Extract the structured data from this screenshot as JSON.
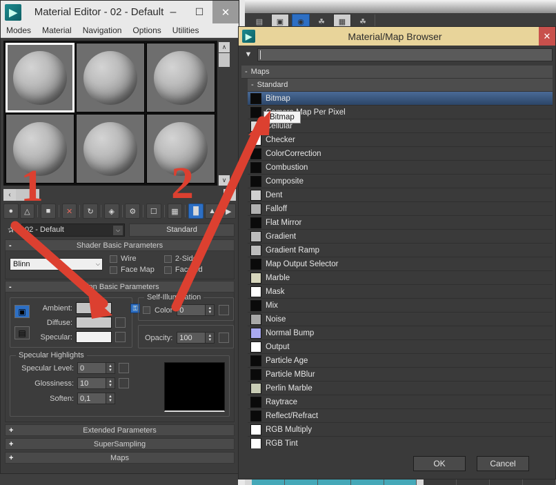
{
  "material_editor": {
    "title": "Material Editor - 02 - Default",
    "logo_glyph": "▶",
    "window_buttons": {
      "minimize": "–",
      "maximize": "☐",
      "close": "✕"
    },
    "menus": [
      "Modes",
      "Material",
      "Navigation",
      "Options",
      "Utilities"
    ],
    "slots": [
      {
        "name": "slot-1",
        "active": true
      },
      {
        "name": "slot-2",
        "active": false
      },
      {
        "name": "slot-3",
        "active": false
      },
      {
        "name": "slot-4",
        "active": false
      },
      {
        "name": "slot-5",
        "active": false
      },
      {
        "name": "slot-6",
        "active": false
      }
    ],
    "slot_scroll": {
      "up": "∧",
      "down": "∨",
      "left": "‹",
      "right": "›"
    },
    "toolbar_icons": [
      "get-material-icon",
      "put-to-scene-icon",
      "assign-to-selection-icon",
      "reset-map-icon",
      "make-material-copy-icon",
      "make-unique-icon",
      "put-to-library-icon",
      "material-effects-channel-icon",
      "show-map-in-viewport-icon",
      "show-end-result-icon",
      "go-to-parent-icon",
      "go-forward-to-sibling-icon"
    ],
    "name_field": {
      "value": "02 - Default",
      "caret": "⌵"
    },
    "type_button": "Standard",
    "pick_icon": "eyedropper-icon",
    "shader_rollout": {
      "title": "Shader Basic Parameters",
      "sign": "-",
      "shader": "Blinn",
      "caret": "⌵",
      "checkboxes": [
        "Wire",
        "2-Sided",
        "Face Map",
        "Faceted"
      ]
    },
    "blinn_rollout": {
      "title": "Blinn Basic Parameters",
      "sign": "-",
      "colors": [
        {
          "label": "Ambient:",
          "value": "#c3c3c3"
        },
        {
          "label": "Diffuse:",
          "value": "#c9c9c9"
        },
        {
          "label": "Specular:",
          "value": "#f2f2f2"
        }
      ],
      "lock_icons": [
        "lock-ambient-diffuse-icon",
        "lock-diffuse-specular-icon"
      ],
      "padlock_glyph": "⚿",
      "self_illumination": {
        "legend": "Self-Illumination",
        "color_label": "Color",
        "value": "0"
      },
      "opacity": {
        "label": "Opacity:",
        "value": "100"
      },
      "specular_highlights": {
        "legend": "Specular Highlights",
        "rows": [
          {
            "label": "Specular Level:",
            "value": "0"
          },
          {
            "label": "Glossiness:",
            "value": "10"
          },
          {
            "label": "Soften:",
            "value": "0,1"
          }
        ]
      },
      "spin_up": "▲",
      "spin_down": "▼"
    },
    "collapsed_rollouts": [
      {
        "sign": "+",
        "title": "Extended Parameters"
      },
      {
        "sign": "+",
        "title": "SuperSampling"
      },
      {
        "sign": "+",
        "title": "Maps"
      }
    ]
  },
  "browser": {
    "title": "Material/Map Browser",
    "logo_glyph": "▶",
    "close": "✕",
    "search": {
      "value": "",
      "placeholder": ""
    },
    "dropdown_glyph": "▼",
    "groups": [
      {
        "sign": "-",
        "label": "Maps"
      },
      {
        "sign": "-",
        "label": "Standard"
      }
    ],
    "tooltip": "Bitmap",
    "items": [
      {
        "label": "Bitmap",
        "swatch": "#0a0a0a",
        "selected": true
      },
      {
        "label": "Camera Map Per Pixel",
        "swatch": "#0a0a0a",
        "selected": false
      },
      {
        "label": "Cellular",
        "swatch": "#dadada",
        "selected": false
      },
      {
        "label": "Checker",
        "swatch": "#ffffff",
        "selected": false
      },
      {
        "label": "ColorCorrection",
        "swatch": "#0a0a0a",
        "selected": false
      },
      {
        "label": "Combustion",
        "swatch": "#0a0a0a",
        "selected": false
      },
      {
        "label": "Composite",
        "swatch": "#0a0a0a",
        "selected": false
      },
      {
        "label": "Dent",
        "swatch": "#cfcfcf",
        "selected": false
      },
      {
        "label": "Falloff",
        "swatch": "#b0b0b0",
        "selected": false
      },
      {
        "label": "Flat Mirror",
        "swatch": "#0a0a0a",
        "selected": false
      },
      {
        "label": "Gradient",
        "swatch": "#bdbdbd",
        "selected": false
      },
      {
        "label": "Gradient Ramp",
        "swatch": "#bdbdbd",
        "selected": false
      },
      {
        "label": "Map Output Selector",
        "swatch": "#0a0a0a",
        "selected": false
      },
      {
        "label": "Marble",
        "swatch": "#d8d7bd",
        "selected": false
      },
      {
        "label": "Mask",
        "swatch": "#ffffff",
        "selected": false
      },
      {
        "label": "Mix",
        "swatch": "#0a0a0a",
        "selected": false
      },
      {
        "label": "Noise",
        "swatch": "#a8a8a8",
        "selected": false
      },
      {
        "label": "Normal Bump",
        "swatch": "#a9a9f0",
        "selected": false
      },
      {
        "label": "Output",
        "swatch": "#ffffff",
        "selected": false
      },
      {
        "label": "Particle Age",
        "swatch": "#0a0a0a",
        "selected": false
      },
      {
        "label": "Particle MBlur",
        "swatch": "#0a0a0a",
        "selected": false
      },
      {
        "label": "Perlin Marble",
        "swatch": "#c9cdb6",
        "selected": false
      },
      {
        "label": "Raytrace",
        "swatch": "#0a0a0a",
        "selected": false
      },
      {
        "label": "Reflect/Refract",
        "swatch": "#0a0a0a",
        "selected": false
      },
      {
        "label": "RGB Multiply",
        "swatch": "#ffffff",
        "selected": false
      },
      {
        "label": "RGB Tint",
        "swatch": "#ffffff",
        "selected": false
      }
    ],
    "buttons": {
      "ok": "OK",
      "cancel": "Cancel"
    }
  },
  "annotations": {
    "color": "#dc4030",
    "marks": [
      {
        "label": "1",
        "target": "diffuse-color-swatch"
      },
      {
        "label": "2",
        "target": "bitmap-list-item"
      }
    ]
  },
  "background": {
    "toolbar_icons": [
      "render-setup-icon",
      "render-frame-icon",
      "render-production-icon",
      "teapot-icon",
      "render-preview-icon",
      "teapot-alt-icon"
    ]
  }
}
